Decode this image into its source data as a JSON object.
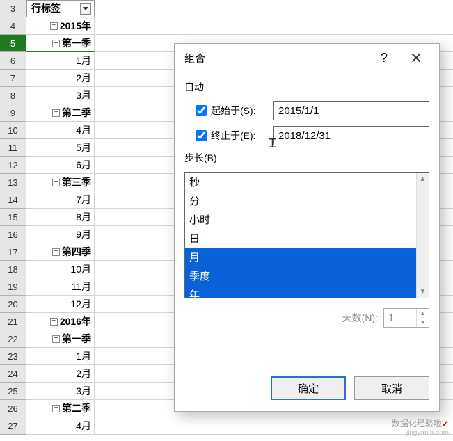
{
  "spreadsheet": {
    "header_label": "行标签",
    "rows": [
      {
        "num": 3,
        "type": "header"
      },
      {
        "num": 4,
        "label": "2015年",
        "bold": true,
        "expander": "−",
        "indent": 0
      },
      {
        "num": 5,
        "label": "第一季",
        "bold": true,
        "expander": "−",
        "indent": 1,
        "selected": true
      },
      {
        "num": 6,
        "label": "1月",
        "indent": 2
      },
      {
        "num": 7,
        "label": "2月",
        "indent": 2
      },
      {
        "num": 8,
        "label": "3月",
        "indent": 2
      },
      {
        "num": 9,
        "label": "第二季",
        "bold": true,
        "expander": "−",
        "indent": 1
      },
      {
        "num": 10,
        "label": "4月",
        "indent": 2
      },
      {
        "num": 11,
        "label": "5月",
        "indent": 2
      },
      {
        "num": 12,
        "label": "6月",
        "indent": 2
      },
      {
        "num": 13,
        "label": "第三季",
        "bold": true,
        "expander": "−",
        "indent": 1
      },
      {
        "num": 14,
        "label": "7月",
        "indent": 2
      },
      {
        "num": 15,
        "label": "8月",
        "indent": 2
      },
      {
        "num": 16,
        "label": "9月",
        "indent": 2
      },
      {
        "num": 17,
        "label": "第四季",
        "bold": true,
        "expander": "−",
        "indent": 1
      },
      {
        "num": 18,
        "label": "10月",
        "indent": 2
      },
      {
        "num": 19,
        "label": "11月",
        "indent": 2
      },
      {
        "num": 20,
        "label": "12月",
        "indent": 2
      },
      {
        "num": 21,
        "label": "2016年",
        "bold": true,
        "expander": "−",
        "indent": 0
      },
      {
        "num": 22,
        "label": "第一季",
        "bold": true,
        "expander": "−",
        "indent": 1
      },
      {
        "num": 23,
        "label": "1月",
        "indent": 2
      },
      {
        "num": 24,
        "label": "2月",
        "indent": 2
      },
      {
        "num": 25,
        "label": "3月",
        "indent": 2
      },
      {
        "num": 26,
        "label": "第二季",
        "bold": true,
        "expander": "−",
        "indent": 1
      },
      {
        "num": 27,
        "label": "4月",
        "indent": 2
      }
    ]
  },
  "dialog": {
    "title": "组合",
    "help_symbol": "?",
    "section_auto": "自动",
    "start_label": "起始于(S):",
    "start_value": "2015/1/1",
    "start_checked": true,
    "end_label": "终止于(E):",
    "end_value": "2018/12/31",
    "end_checked": true,
    "step_label": "步长(B)",
    "step_items": [
      {
        "label": "秒",
        "selected": false
      },
      {
        "label": "分",
        "selected": false
      },
      {
        "label": "小时",
        "selected": false
      },
      {
        "label": "日",
        "selected": false
      },
      {
        "label": "月",
        "selected": true
      },
      {
        "label": "季度",
        "selected": true
      },
      {
        "label": "年",
        "selected": true
      }
    ],
    "days_label": "天数(N):",
    "days_value": "1",
    "ok_label": "确定",
    "cancel_label": "取消"
  },
  "watermark": {
    "line1": "数据化经验啦",
    "check": "✓",
    "line2": "jingyanla.com"
  }
}
